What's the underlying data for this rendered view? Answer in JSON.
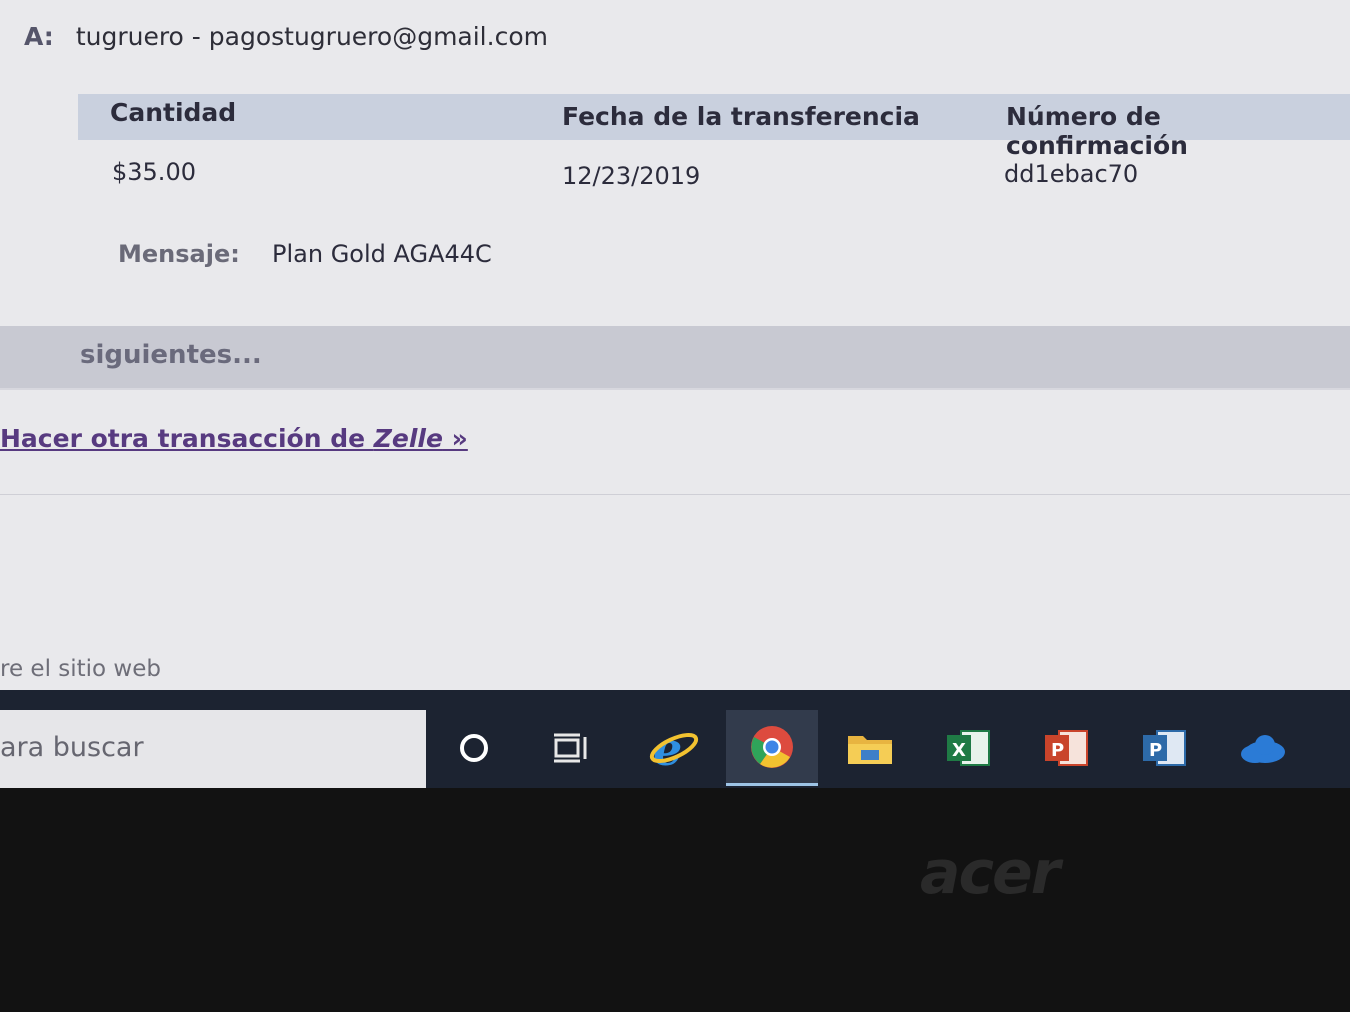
{
  "recipient": {
    "label": "A:",
    "value": "tugruero - pagostugruero@gmail.com"
  },
  "table": {
    "headers": [
      "Cantidad",
      "Fecha de la transferencia",
      "Número de confirmación"
    ],
    "row": {
      "amount": "$35.00",
      "date": "12/23/2019",
      "confirmation": "dd1ebac70"
    }
  },
  "message": {
    "label": "Mensaje:",
    "value": "Plan Gold AGA44C"
  },
  "next_steps": {
    "title": "siguientes..."
  },
  "actions": {
    "zelle_prefix": "Hacer otra transacción de ",
    "zelle_brand": "Zelle",
    "zelle_suffix": " »"
  },
  "footer": {
    "link": "re el sitio web"
  },
  "taskbar": {
    "search_placeholder": "ara buscar",
    "icons": [
      "cortana-icon",
      "task-view-icon",
      "internet-explorer-icon",
      "chrome-icon",
      "file-explorer-icon",
      "excel-icon",
      "powerpoint-icon",
      "project-icon",
      "onedrive-icon"
    ],
    "active_icon": "chrome-icon"
  },
  "bezel": {
    "brand": "acer"
  },
  "colors": {
    "header_band": "#c9d0de",
    "link": "#573a80",
    "taskbar": "#1c2331"
  }
}
